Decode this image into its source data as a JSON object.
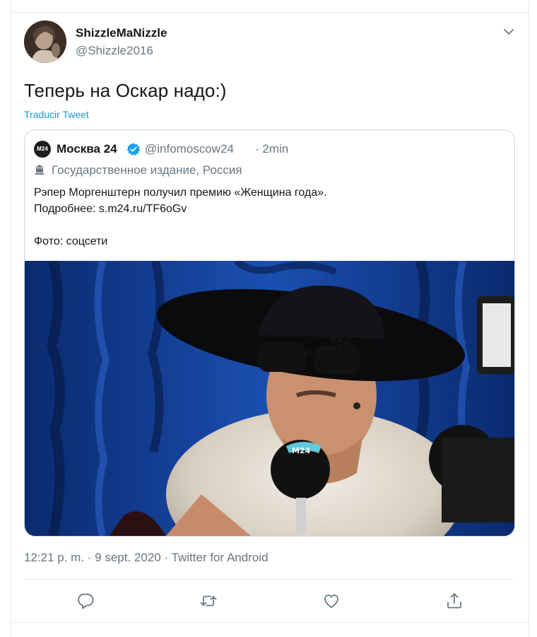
{
  "tweet": {
    "display_name": "ShizzleMaNizzle",
    "handle": "@Shizzle2016",
    "text": "Теперь на Оскар надо:)",
    "translate_label": "Traducir Tweet",
    "timestamp": "12:21 p. m. · 9 sept. 2020 · Twitter for Android"
  },
  "quoted": {
    "logo_text": "M24",
    "name": "Москва 24",
    "handle": "@infomoscow24",
    "time": "· 2min",
    "label": "Государственное издание, Россия",
    "body_lines": [
      "Рэпер Моргенштерн получил премию «Женщина года».",
      "Подробнее: s.m24.ru/TF6oGv",
      "",
      "Фото: соцсети"
    ],
    "photo_mic_text": "M24"
  },
  "icons": {
    "caret": "chevron-down-icon",
    "verified": "verified-badge-icon",
    "label": "government-building-icon",
    "reply": "reply-icon",
    "retweet": "retweet-icon",
    "like": "heart-icon",
    "share": "share-icon"
  },
  "colors": {
    "accent": "#1b95e0",
    "verified": "#1da1f2",
    "secondary_text": "#657786",
    "border": "#e6ecf0"
  }
}
